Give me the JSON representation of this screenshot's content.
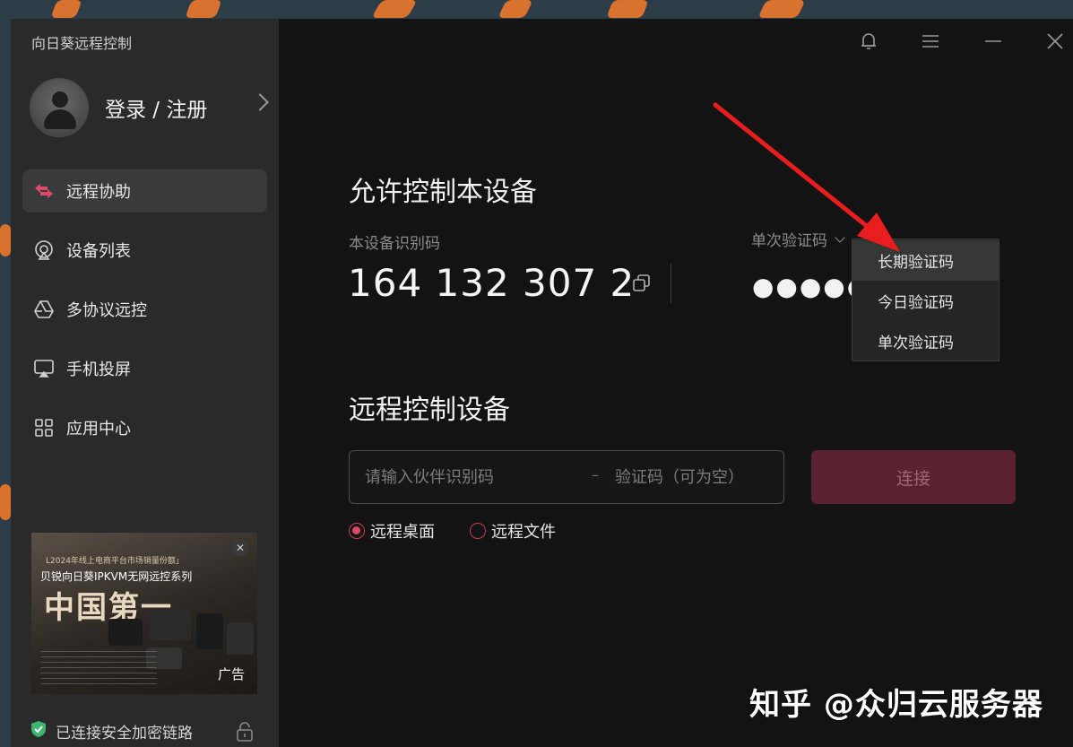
{
  "app": {
    "title": "向日葵远程控制"
  },
  "account": {
    "login_label": "登录 / 注册"
  },
  "sidebar": {
    "items": [
      {
        "label": "远程协助",
        "icon": "remote-assist-icon",
        "active": true
      },
      {
        "label": "设备列表",
        "icon": "device-list-icon",
        "active": false
      },
      {
        "label": "多协议远控",
        "icon": "multi-protocol-icon",
        "active": false
      },
      {
        "label": "手机投屏",
        "icon": "screen-cast-icon",
        "active": false
      },
      {
        "label": "应用中心",
        "icon": "app-center-icon",
        "active": false
      }
    ]
  },
  "ad": {
    "line1": "L2024年线上电商平台市场销量份额」",
    "line2": "贝锐向日葵IPKVM无网远控系列",
    "headline": "中国第一",
    "tag": "广告"
  },
  "status": {
    "secure_text": "已连接安全加密链路"
  },
  "allow": {
    "heading": "允许控制本设备",
    "device_id_label": "本设备识别码",
    "device_id": "164 132 307 2",
    "code_type_label": "单次验证码",
    "code_masked": "●●●●●●"
  },
  "dropdown": {
    "options": [
      "长期验证码",
      "今日验证码",
      "单次验证码"
    ],
    "hovered_index": 0
  },
  "remote": {
    "heading": "远程控制设备",
    "partner_id_placeholder": "请输入伙伴识别码",
    "separator": "–",
    "code_placeholder": "验证码（可为空）",
    "connect_label": "连接",
    "modes": [
      {
        "label": "远程桌面",
        "selected": true
      },
      {
        "label": "远程文件",
        "selected": false
      }
    ]
  },
  "watermark": {
    "text": "知乎 @众归云服务器"
  },
  "colors": {
    "accent": "#e04867",
    "connect_disabled_bg": "#5a2130",
    "annotation_arrow": "#e81d1d",
    "secure_green": "#3fb66f"
  }
}
